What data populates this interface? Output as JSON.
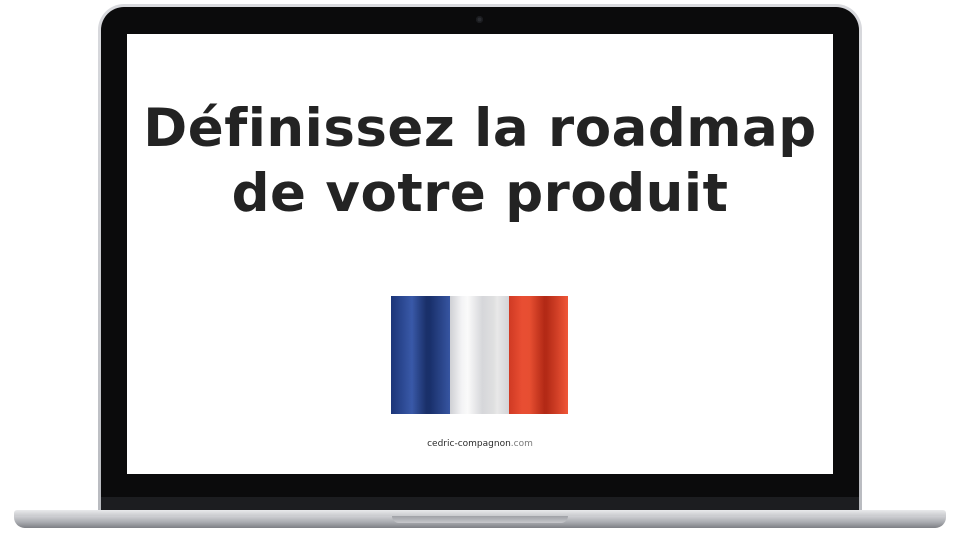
{
  "screen": {
    "headline_line1": "Définissez la roadmap",
    "headline_line2": "de votre produit",
    "flag": {
      "country": "France",
      "colors": [
        "#2d4fa3",
        "#ffffff",
        "#ef4a2a"
      ]
    },
    "footer": {
      "domain_name": "cedric-compagnon",
      "domain_tld": ".com"
    }
  },
  "device": {
    "type": "laptop",
    "icons": [
      "camera-icon"
    ]
  }
}
